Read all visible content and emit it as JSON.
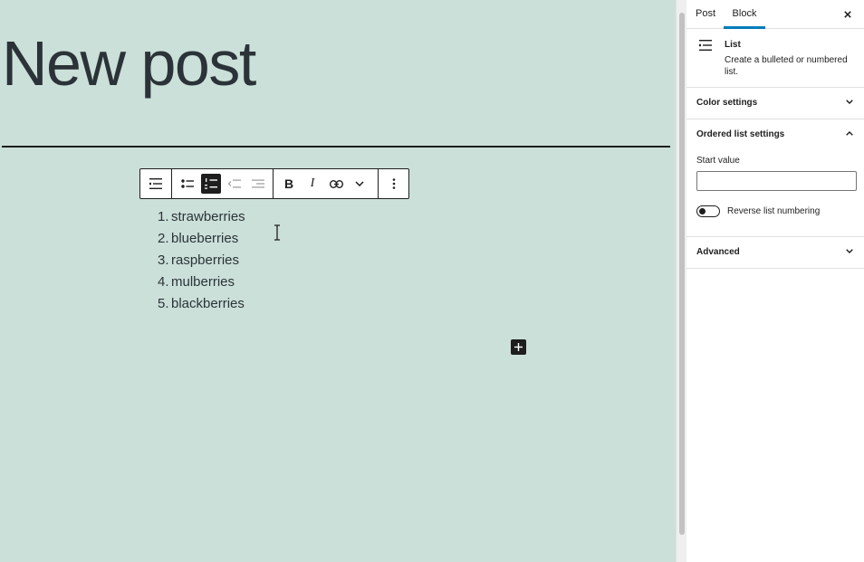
{
  "editor": {
    "post_title": "New post",
    "list_items": [
      {
        "num": "1.",
        "text": "strawberries"
      },
      {
        "num": "2.",
        "text": "blueberries"
      },
      {
        "num": "3.",
        "text": "raspberries"
      },
      {
        "num": "4.",
        "text": "mulberries"
      },
      {
        "num": "5.",
        "text": "blackberries"
      }
    ],
    "toolbar": {
      "icons": [
        "block-type-list-icon",
        "unordered-list-icon",
        "ordered-list-icon",
        "outdent-icon",
        "indent-icon",
        "bold-icon",
        "italic-icon",
        "link-icon",
        "more-rich-text-icon",
        "options-icon"
      ],
      "bold": "B",
      "italic": "I"
    }
  },
  "sidebar": {
    "tabs": {
      "post": "Post",
      "block": "Block"
    },
    "active_tab": "Block",
    "block_card": {
      "name": "List",
      "description": "Create a bulleted or numbered list."
    },
    "panels": {
      "color_settings": "Color settings",
      "ordered_list_settings": "Ordered list settings",
      "start_value_label": "Start value",
      "start_value": "",
      "reverse_label": "Reverse list numbering",
      "advanced": "Advanced"
    }
  },
  "colors": {
    "canvas_bg": "#cbe0d8",
    "accent": "#007cba",
    "text": "#1e1e1e"
  }
}
